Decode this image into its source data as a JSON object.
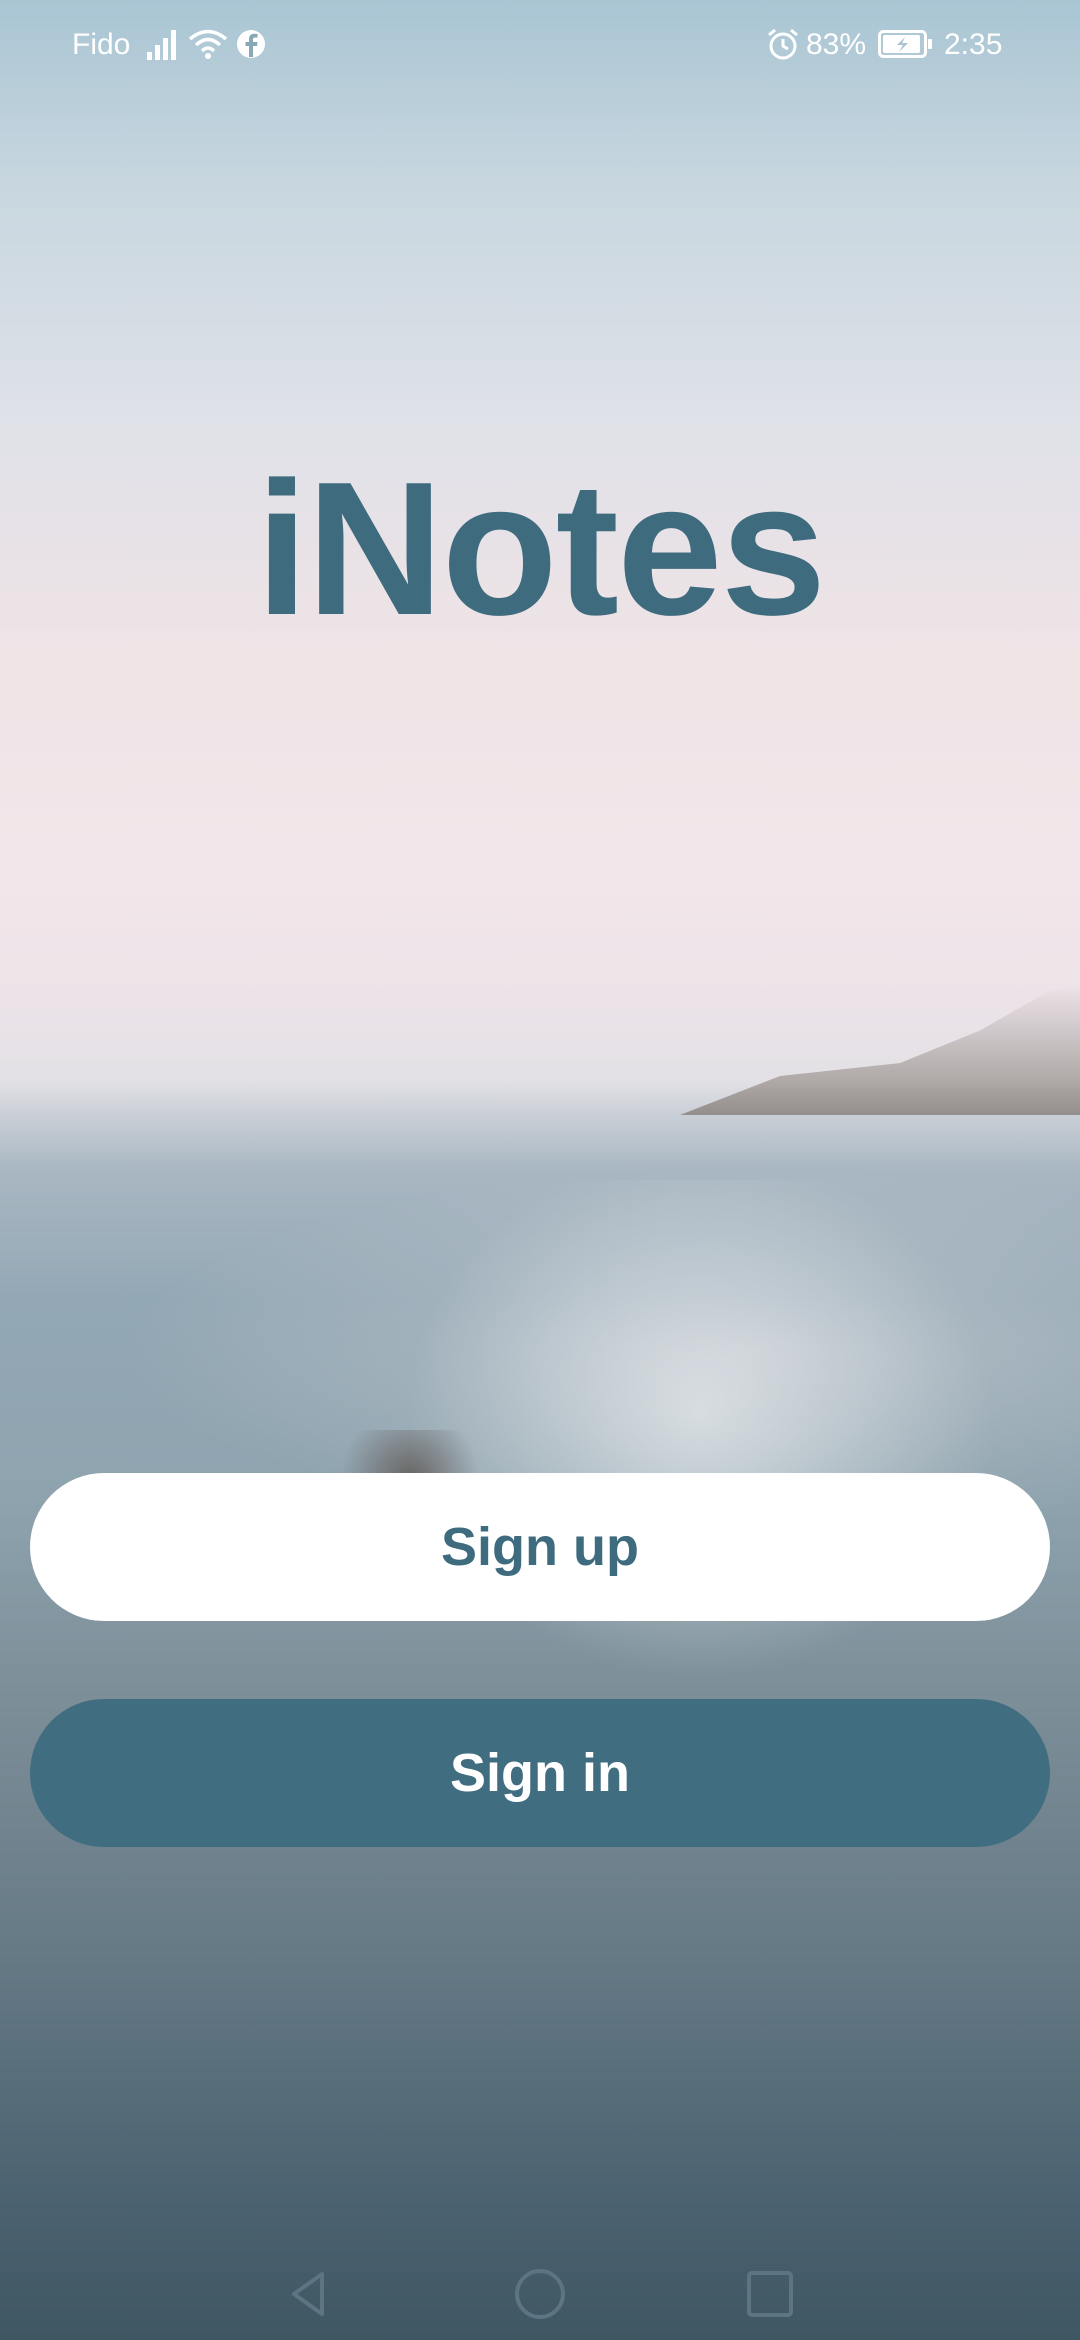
{
  "status_bar": {
    "carrier": "Fido",
    "battery": "83%",
    "time": "2:35",
    "icons": [
      "signal-icon",
      "wifi-icon",
      "facebook-icon",
      "alarm-icon",
      "battery-charging-icon"
    ]
  },
  "app": {
    "title": "iNotes"
  },
  "buttons": {
    "signup_label": "Sign up",
    "signin_label": "Sign in"
  },
  "nav_bar": {
    "icons": [
      "back-icon",
      "home-icon",
      "recents-icon"
    ]
  },
  "colors": {
    "accent": "#406d7f",
    "title": "#3f6b7f",
    "button_light": "#ffffff"
  }
}
